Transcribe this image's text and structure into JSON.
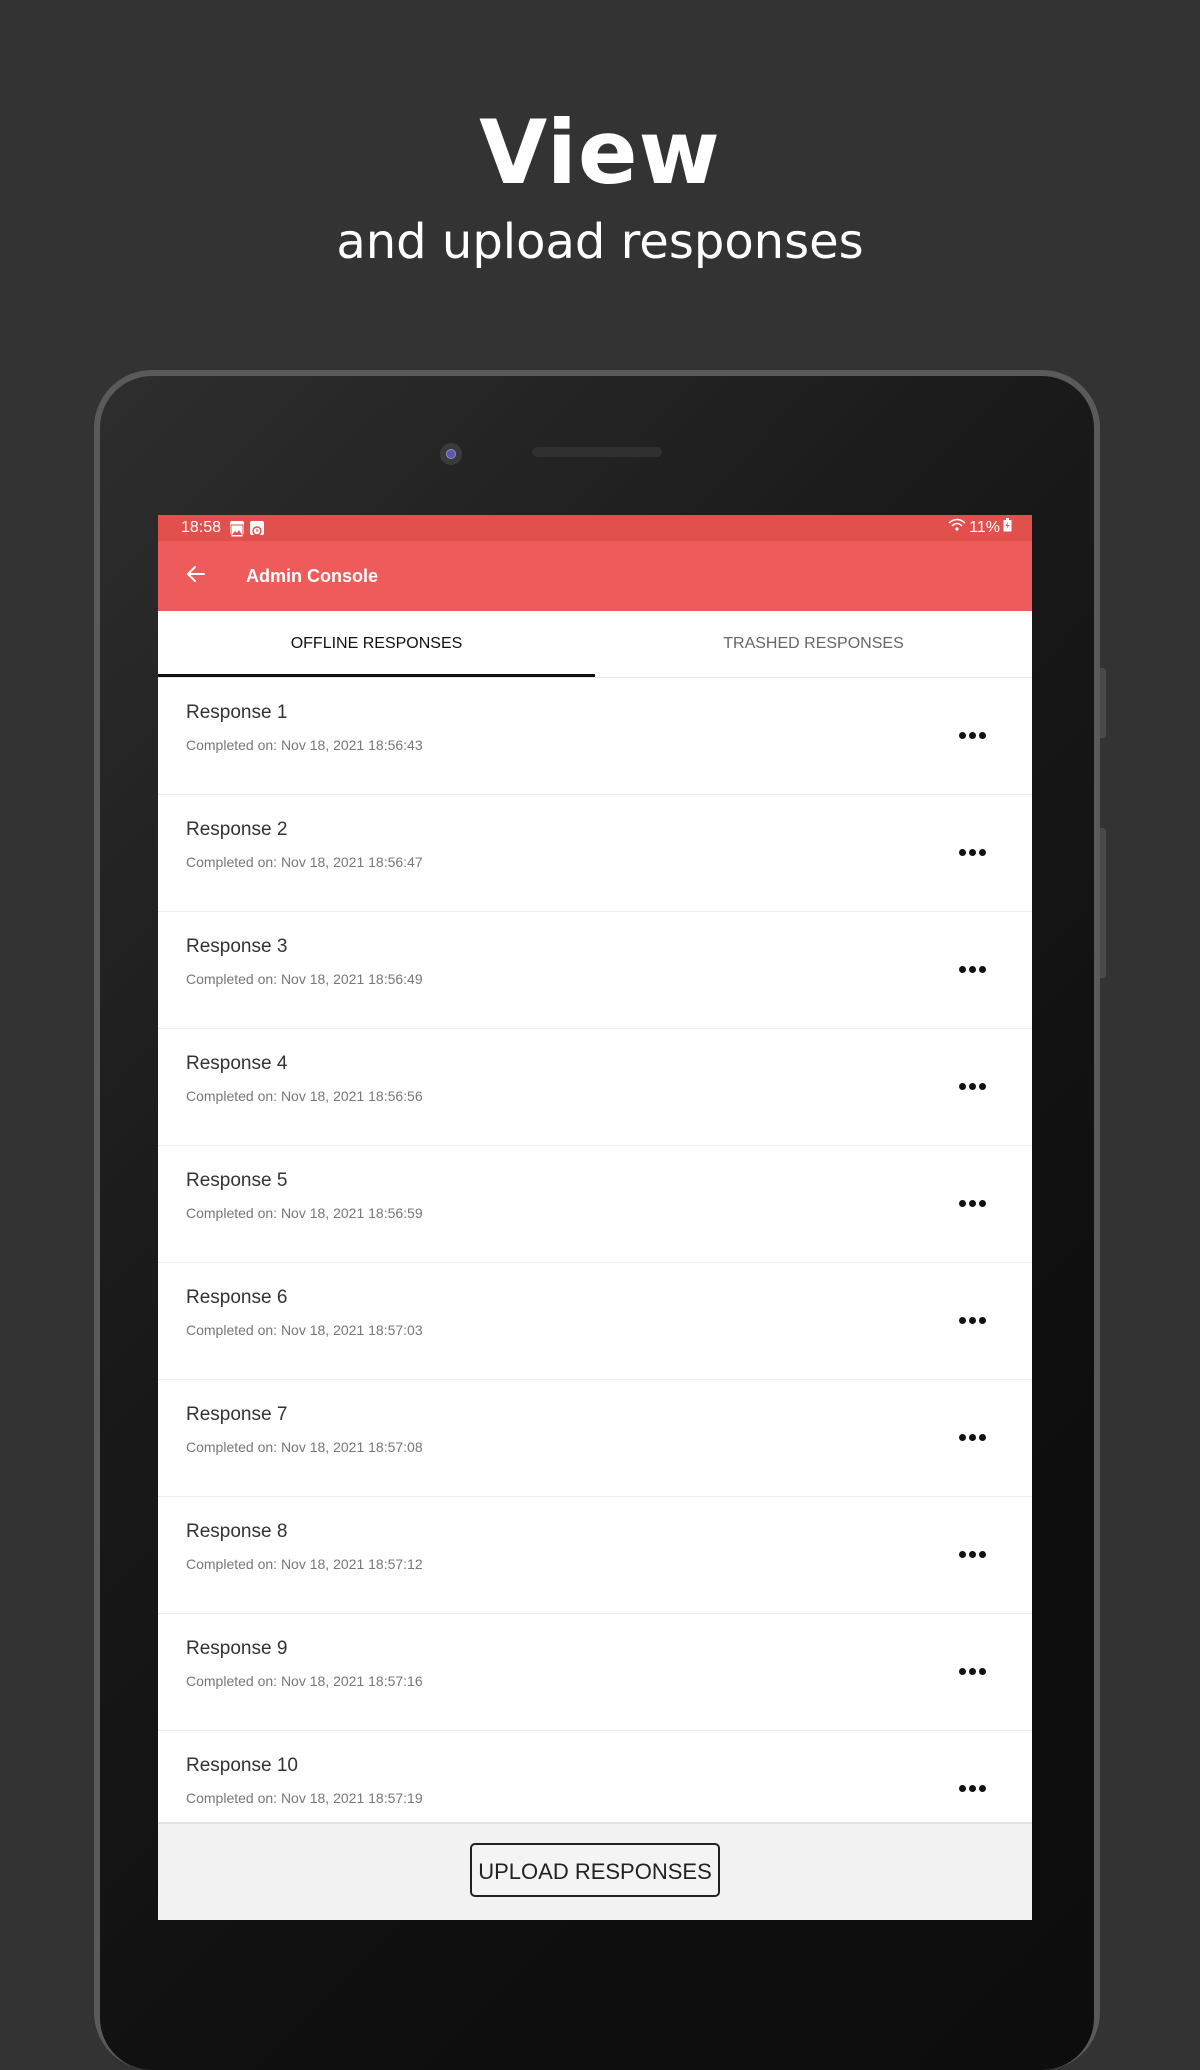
{
  "hero": {
    "title": "View",
    "subtitle": "and upload responses"
  },
  "status_bar": {
    "time": "18:58",
    "battery": "11%",
    "left_icons": [
      "image-icon",
      "clock-icon"
    ],
    "right_icons": [
      "wifi-icon",
      "battery-charging-icon"
    ]
  },
  "app_bar": {
    "title": "Admin Console",
    "back_icon": "arrow-left-icon",
    "color": "#ef5b5a"
  },
  "tabs": [
    {
      "label": "OFFLINE RESPONSES",
      "active": true
    },
    {
      "label": "TRASHED RESPONSES",
      "active": false
    }
  ],
  "responses": [
    {
      "title": "Response 1",
      "completed": "Completed on: Nov 18, 2021 18:56:43"
    },
    {
      "title": "Response 2",
      "completed": "Completed on: Nov 18, 2021 18:56:47"
    },
    {
      "title": "Response 3",
      "completed": "Completed on: Nov 18, 2021 18:56:49"
    },
    {
      "title": "Response 4",
      "completed": "Completed on: Nov 18, 2021 18:56:56"
    },
    {
      "title": "Response 5",
      "completed": "Completed on: Nov 18, 2021 18:56:59"
    },
    {
      "title": "Response 6",
      "completed": "Completed on: Nov 18, 2021 18:57:03"
    },
    {
      "title": "Response 7",
      "completed": "Completed on: Nov 18, 2021 18:57:08"
    },
    {
      "title": "Response 8",
      "completed": "Completed on: Nov 18, 2021 18:57:12"
    },
    {
      "title": "Response 9",
      "completed": "Completed on: Nov 18, 2021 18:57:16"
    },
    {
      "title": "Response 10",
      "completed": "Completed on: Nov 18, 2021 18:57:19"
    }
  ],
  "row_menu_icon": "more-horizontal-icon",
  "footer": {
    "upload_label": "UPLOAD RESPONSES"
  }
}
